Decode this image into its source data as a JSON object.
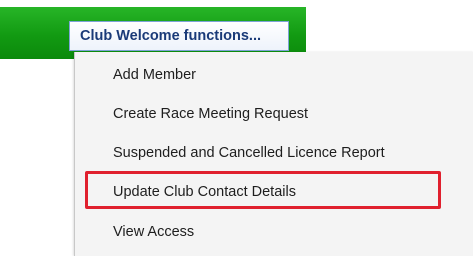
{
  "menu": {
    "trigger_label": "Club Welcome functions...",
    "items": [
      {
        "label": "Add Member"
      },
      {
        "label": "Create Race Meeting Request"
      },
      {
        "label": "Suspended and Cancelled Licence Report"
      },
      {
        "label": "Update Club Contact Details"
      },
      {
        "label": "View Access"
      }
    ],
    "highlighted_item": "Update Club Contact Details"
  },
  "colors": {
    "header_green": "#129a12",
    "trigger_text": "#1a3a78",
    "highlight_border": "#e0202e",
    "menu_background": "#f4f4f4"
  }
}
